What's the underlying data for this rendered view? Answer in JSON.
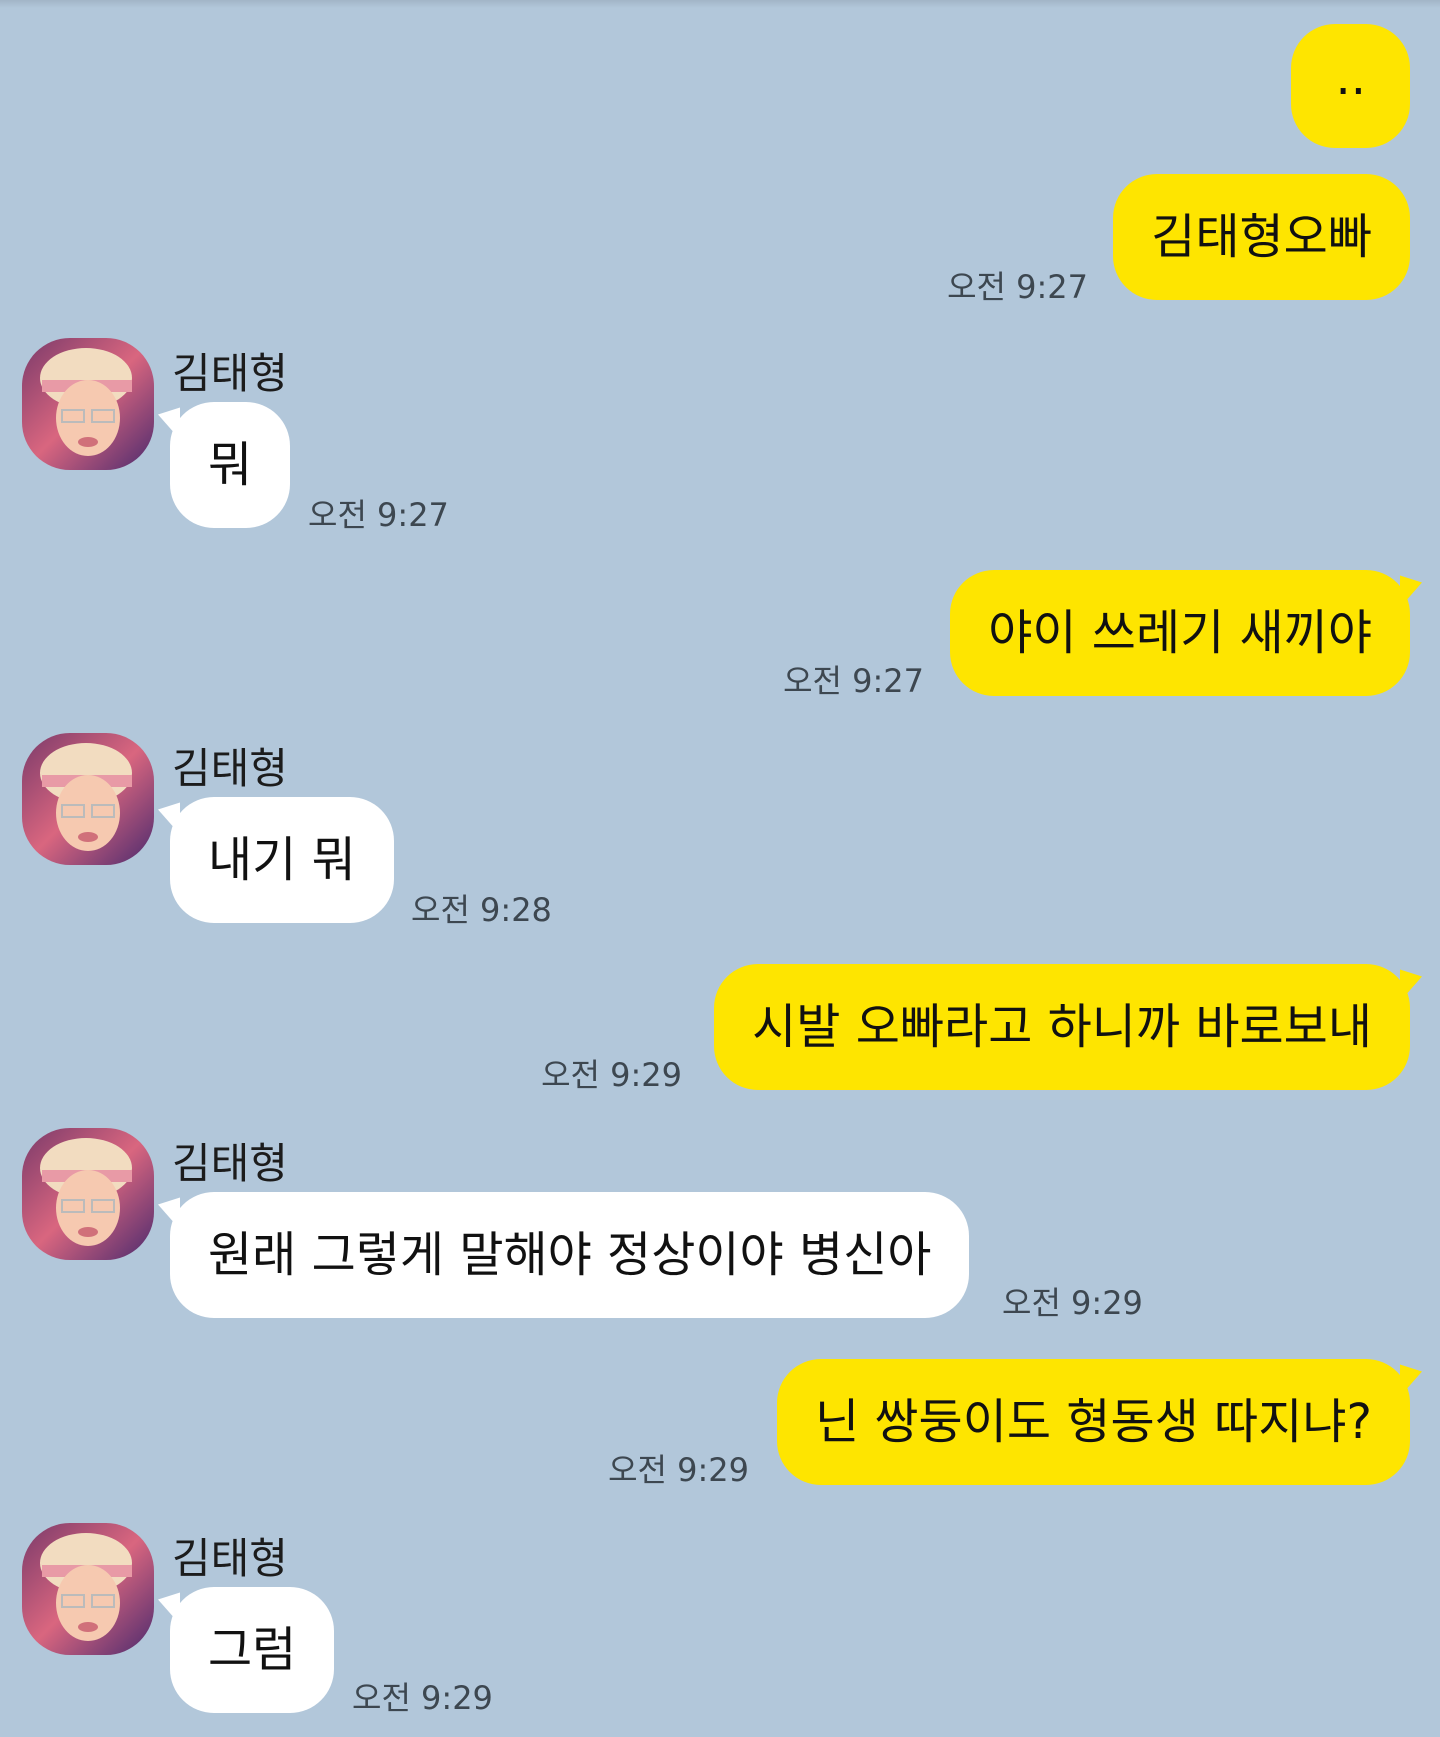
{
  "chat": {
    "contact_name": "김태형",
    "messages": [
      {
        "from": "me",
        "text": "..",
        "time": ""
      },
      {
        "from": "me",
        "text": "김태형오빠",
        "time": "오전 9:27"
      },
      {
        "from": "other",
        "sender": "김태형",
        "text": "뭐",
        "time": "오전 9:27"
      },
      {
        "from": "me",
        "text": "야이 쓰레기 새끼야",
        "time": "오전 9:27"
      },
      {
        "from": "other",
        "sender": "김태형",
        "text": "내기 뭐",
        "time": "오전 9:28"
      },
      {
        "from": "me",
        "text": "시발 오빠라고 하니까 바로보내",
        "time": "오전 9:29"
      },
      {
        "from": "other",
        "sender": "김태형",
        "text": "원래 그렇게 말해야 정상이야 병신아",
        "time": "오전 9:29"
      },
      {
        "from": "me",
        "text": "닌 쌍둥이도 형동생 따지냐?",
        "time": "오전 9:29"
      },
      {
        "from": "other",
        "sender": "김태형",
        "text": "그럼",
        "time": "오전 9:29"
      }
    ]
  },
  "colors": {
    "background": "#b2c7da",
    "my_bubble": "#fee500",
    "their_bubble": "#ffffff",
    "timestamp": "#3d4750"
  },
  "icons": {
    "avatar": "profile-photo-avatar"
  }
}
